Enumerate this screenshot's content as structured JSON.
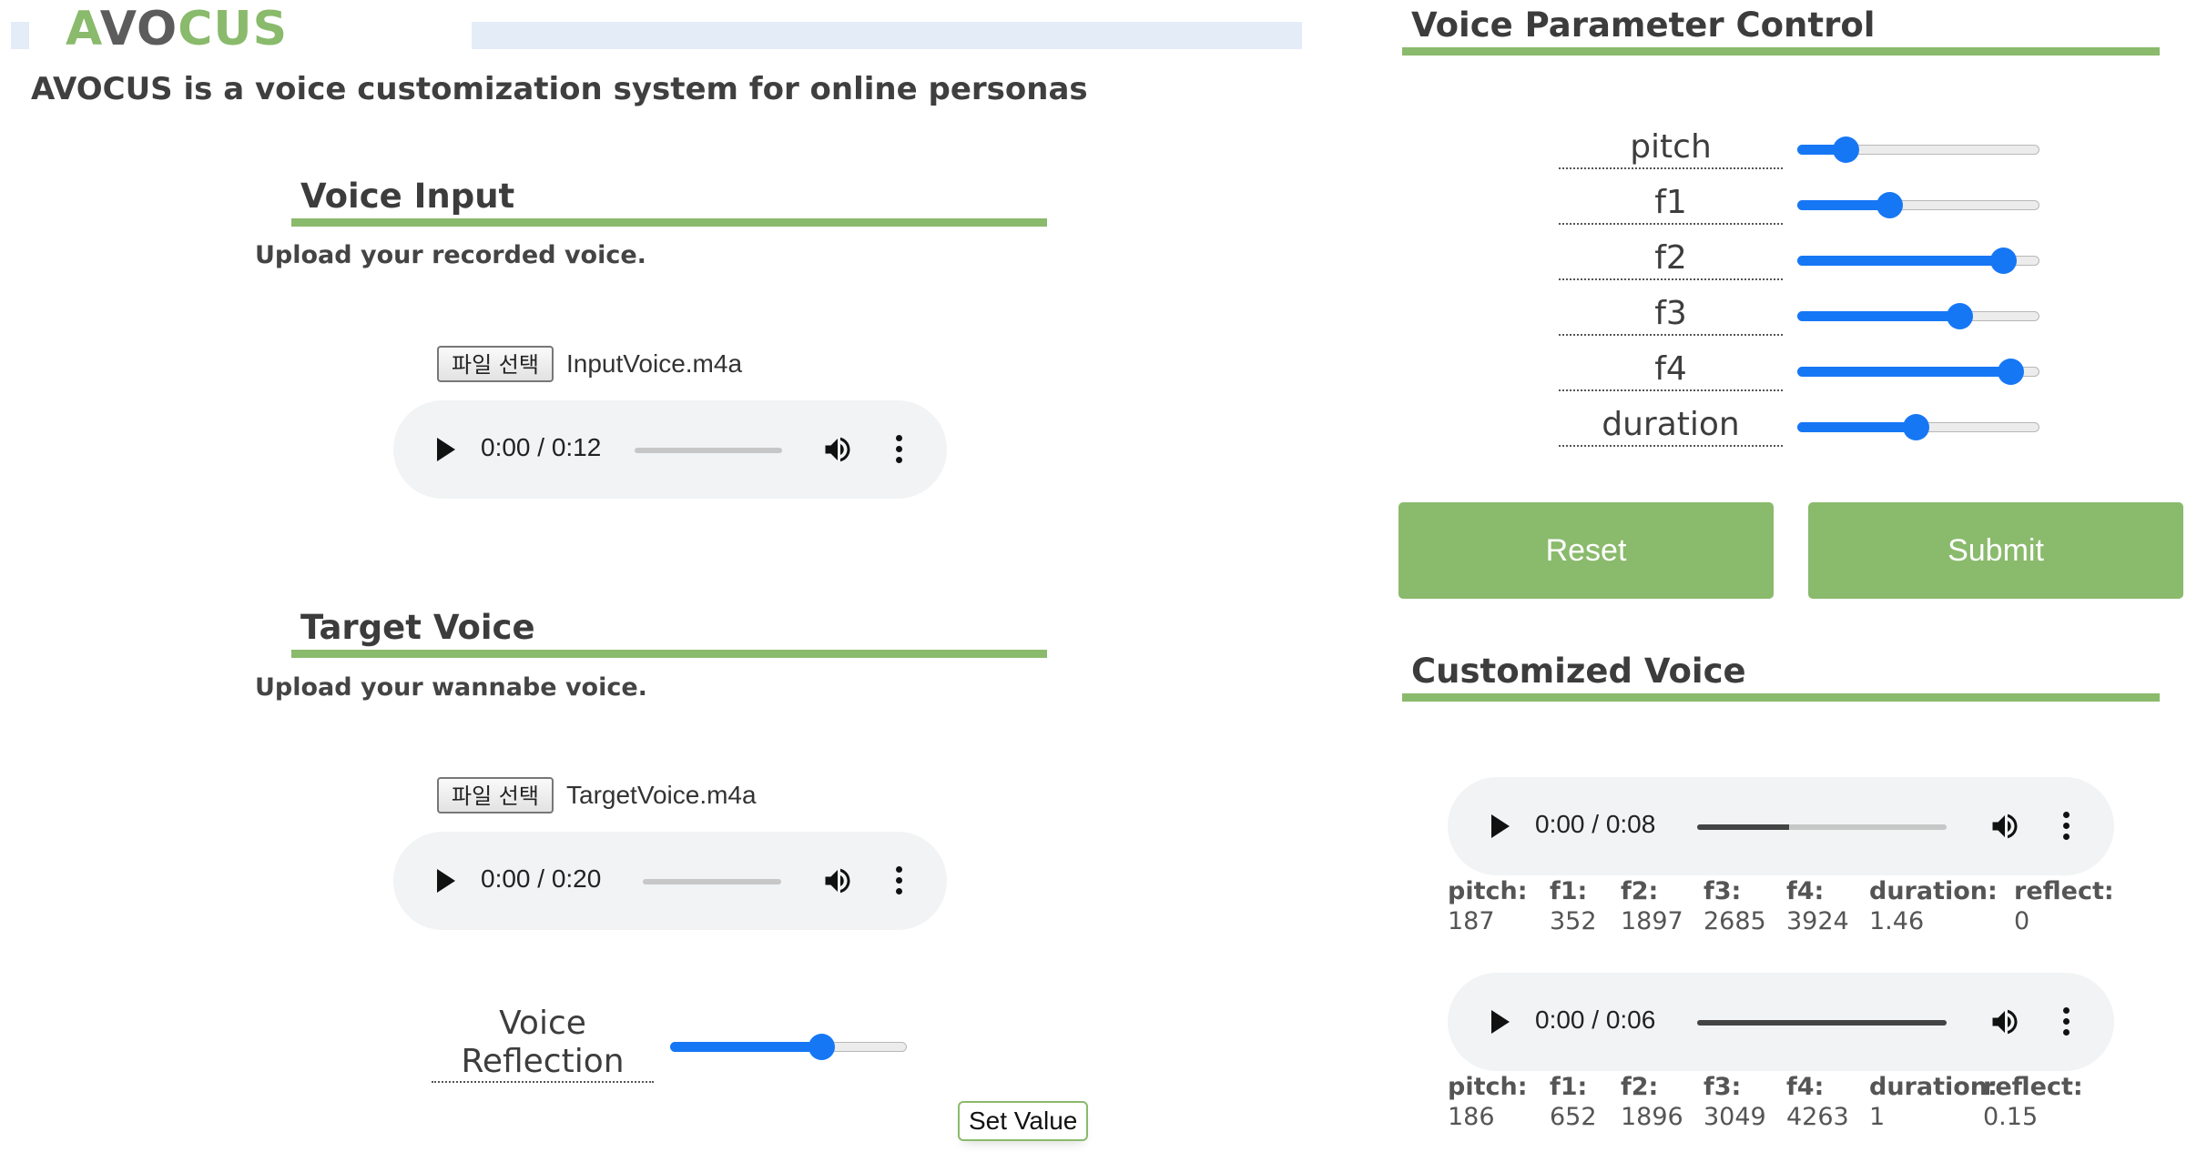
{
  "header": {
    "logo_part1": "A",
    "logo_part2": "VO",
    "logo_part3": "CUS",
    "tagline": "AVOCUS is a voice customization system for online personas"
  },
  "voice_input": {
    "title": "Voice Input",
    "description": "Upload your recorded voice.",
    "file_button": "파일 선택",
    "file_name": "InputVoice.m4a",
    "player": {
      "time": "0:00 / 0:12",
      "progress": 0
    }
  },
  "target_voice": {
    "title": "Target Voice",
    "description": "Upload your wannabe voice.",
    "file_button": "파일 선택",
    "file_name": "TargetVoice.m4a",
    "player": {
      "time": "0:00 / 0:20",
      "progress": 0
    },
    "reflection_label_line1": "Voice",
    "reflection_label_line2": "Reflection",
    "reflection_level": 0.64,
    "set_button": "Set Value"
  },
  "parameter_control": {
    "title": "Voice Parameter Control",
    "sliders": [
      {
        "label": "pitch",
        "level": 0.2
      },
      {
        "label": "f1",
        "level": 0.38
      },
      {
        "label": "f2",
        "level": 0.85
      },
      {
        "label": "f3",
        "level": 0.67
      },
      {
        "label": "f4",
        "level": 0.88
      },
      {
        "label": "duration",
        "level": 0.49
      }
    ],
    "reset_label": "Reset",
    "submit_label": "Submit"
  },
  "customized_voice": {
    "title": "Customized Voice",
    "results": [
      {
        "player": {
          "time": "0:00 / 0:08",
          "progress": 0.37
        },
        "stats": [
          {
            "label": "pitch:",
            "value": "187"
          },
          {
            "label": "f1:",
            "value": "352"
          },
          {
            "label": "f2:",
            "value": "1897"
          },
          {
            "label": "f3:",
            "value": "2685"
          },
          {
            "label": "f4:",
            "value": "3924"
          },
          {
            "label": "duration:",
            "value": "1.46"
          },
          {
            "label": "reflect:",
            "value": "0"
          }
        ]
      },
      {
        "player": {
          "time": "0:00 / 0:06",
          "progress": 1.0
        },
        "stats": [
          {
            "label": "pitch:",
            "value": "186"
          },
          {
            "label": "f1:",
            "value": "652"
          },
          {
            "label": "f2:",
            "value": "1896"
          },
          {
            "label": "f3:",
            "value": "3049"
          },
          {
            "label": "f4:",
            "value": "4263"
          },
          {
            "label": "duration:",
            "value": "1"
          },
          {
            "label": "reflect:",
            "value": "0.15"
          }
        ]
      }
    ]
  },
  "colors": {
    "accent_green": "#8aba6c",
    "slider_blue": "#1677f5",
    "header_blue": "#e4ecf8"
  }
}
